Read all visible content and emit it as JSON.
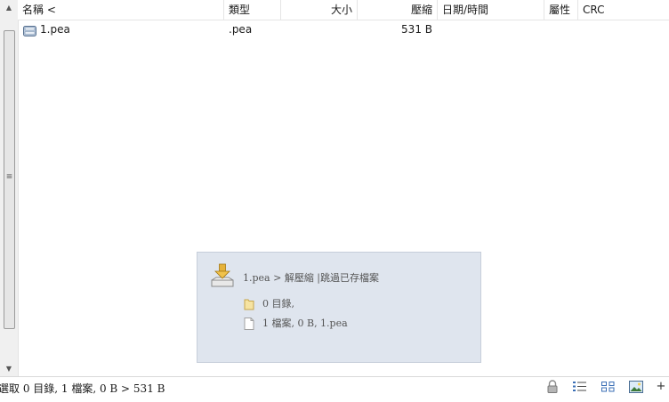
{
  "columns": {
    "name": "名稱 <",
    "type": "類型",
    "size": "大小",
    "compressed": "壓縮",
    "date": "日期/時間",
    "attributes": "屬性",
    "crc": "CRC"
  },
  "files": [
    {
      "name": "1.pea",
      "type": ".pea",
      "size": "",
      "compressed": "531 B",
      "date": "",
      "attributes": "",
      "crc": "",
      "icon": "archive-file-icon"
    }
  ],
  "info_panel": {
    "title": "1.pea > 解壓縮 |跳過已存檔案",
    "dirs": "0 目錄,",
    "files": "1 檔案, 0 B, 1.pea",
    "icon": "extract-icon"
  },
  "status": {
    "text": "選取 0 目錄, 1 檔案, 0 B > 531 B",
    "buttons": [
      "lock-icon",
      "details-view-icon",
      "tiles-view-icon",
      "thumbnail-view-icon",
      "plus-icon"
    ],
    "plus_label": "+"
  },
  "colors": {
    "panel_bg": "#dfe5ee",
    "accent": "#2a5fa8"
  }
}
